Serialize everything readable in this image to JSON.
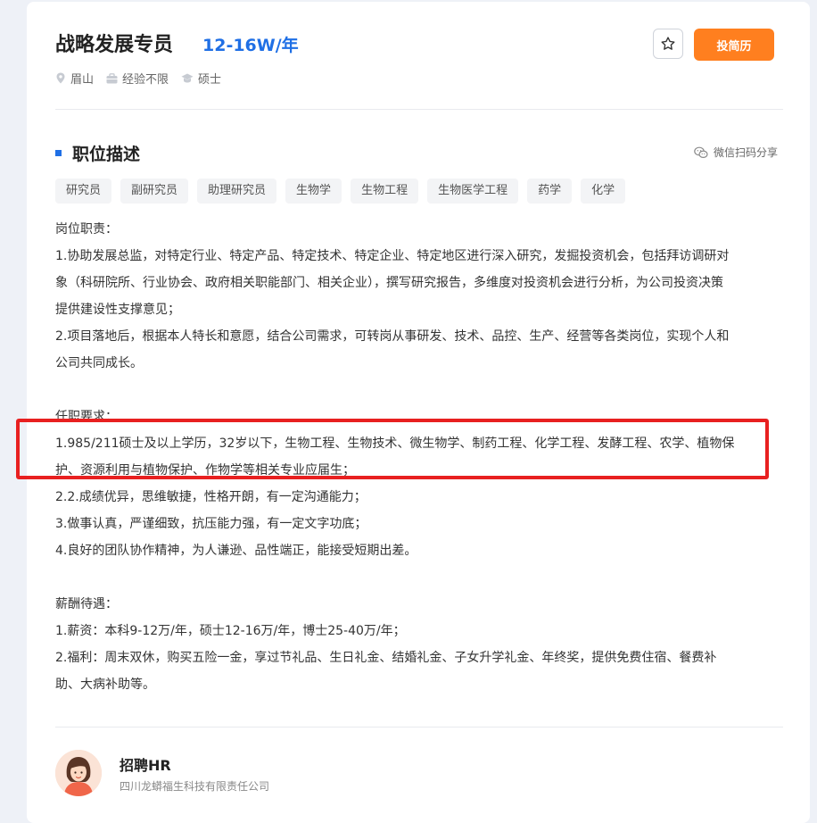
{
  "job": {
    "title": "战略发展专员",
    "salary": "12-16W/年",
    "location": "眉山",
    "experience": "经验不限",
    "education": "硕士"
  },
  "actions": {
    "apply_label": "投简历",
    "favorite_icon": "star-icon"
  },
  "section": {
    "title": "职位描述",
    "share_label": "微信扫码分享"
  },
  "tags": [
    "研究员",
    "副研究员",
    "助理研究员",
    "生物学",
    "生物工程",
    "生物医学工程",
    "药学",
    "化学"
  ],
  "description": [
    "岗位职责：",
    "1.协助发展总监，对特定行业、特定产品、特定技术、特定企业、特定地区进行深入研究，发掘投资机会，包括拜访调研对",
    "象（科研院所、行业协会、政府相关职能部门、相关企业），撰写研究报告，多维度对投资机会进行分析，为公司投资决策",
    "提供建设性支撑意见；",
    "2.项目落地后，根据本人特长和意愿，结合公司需求，可转岗从事研发、技术、品控、生产、经营等各类岗位，实现个人和",
    "公司共同成长。",
    "",
    "任职要求：",
    "1.985/211硕士及以上学历，32岁以下，生物工程、生物技术、微生物学、制药工程、化学工程、发酵工程、农学、植物保",
    "护、资源利用与植物保护、作物学等相关专业应届生；",
    "2.2.成绩优异，思维敏捷，性格开朗，有一定沟通能力；",
    "3.做事认真，严谨细致，抗压能力强，有一定文字功底；",
    "4.良好的团队协作精神，为人谦逊、品性端正，能接受短期出差。",
    "",
    "薪酬待遇：",
    "1.薪资：本科9-12万/年，硕士12-16万/年，博士25-40万/年；",
    "2.福利：周末双休，购买五险一金，享过节礼品、生日礼金、结婚礼金、子女升学礼金、年终奖，提供免费住宿、餐费补",
    "助、大病补助等。"
  ],
  "hr": {
    "name": "招聘HR",
    "company": "四川龙蟒福生科技有限责任公司"
  },
  "colors": {
    "accent": "#1f6fe5",
    "apply": "#ff7f1f",
    "highlight": "#e82020"
  }
}
